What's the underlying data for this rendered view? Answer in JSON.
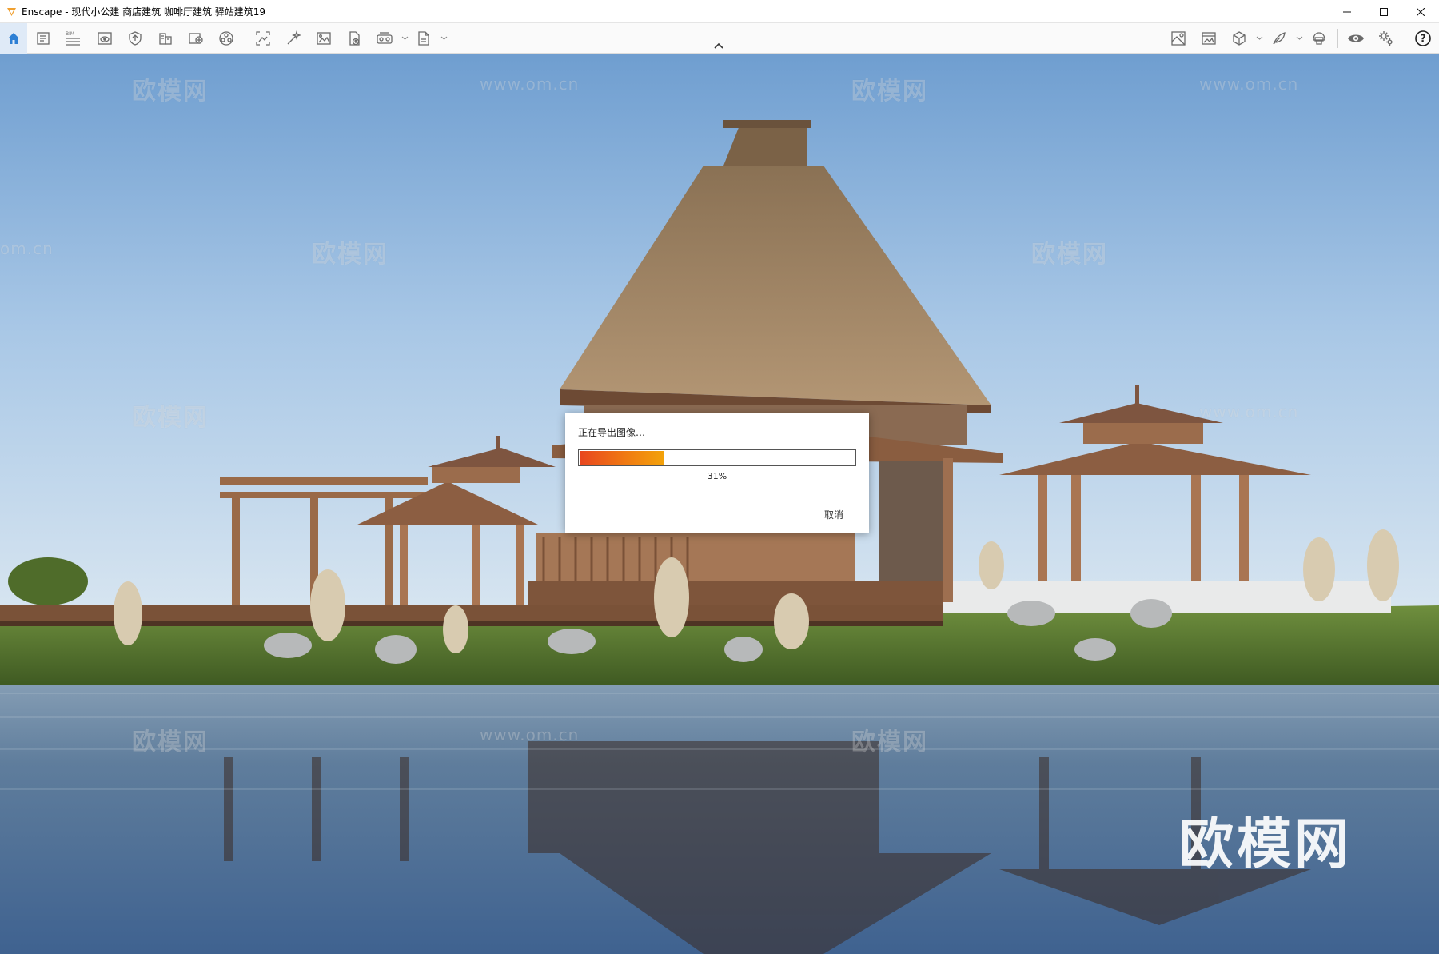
{
  "window": {
    "title": "Enscape - 现代小公建 商店建筑 咖啡厅建筑 驿站建筑19",
    "controls": [
      "minimize-icon",
      "maximize-icon",
      "close-icon"
    ]
  },
  "toolbar": {
    "left_icons": [
      "home-icon",
      "report-icon",
      "bim-icon",
      "view-icon",
      "shield-icon",
      "building-icon",
      "export-icon",
      "sphere-icon",
      "screenshot-icon",
      "wand-icon",
      "image-icon",
      "upload-icon",
      "vr-icon",
      "pdf-icon"
    ],
    "bim_label": "BIM",
    "right_icons": [
      "asset-library-icon",
      "gallery-icon",
      "cube-icon",
      "feather-icon",
      "helmet-icon",
      "eye-icon",
      "settings-icon",
      "help-icon"
    ],
    "help_label": "?"
  },
  "dialog": {
    "title": "正在导出图像…",
    "progress": 0.31,
    "percent_label": "31%",
    "cancel_label": "取消"
  },
  "watermark": {
    "brand": "欧模网",
    "url": "www.om.cn",
    "url_fragment": "om.cn"
  },
  "colors": {
    "accent": "#2d7fd4",
    "progress_start": "#e8461f",
    "progress_end": "#f3a20a",
    "app_icon": "#f0a030"
  }
}
